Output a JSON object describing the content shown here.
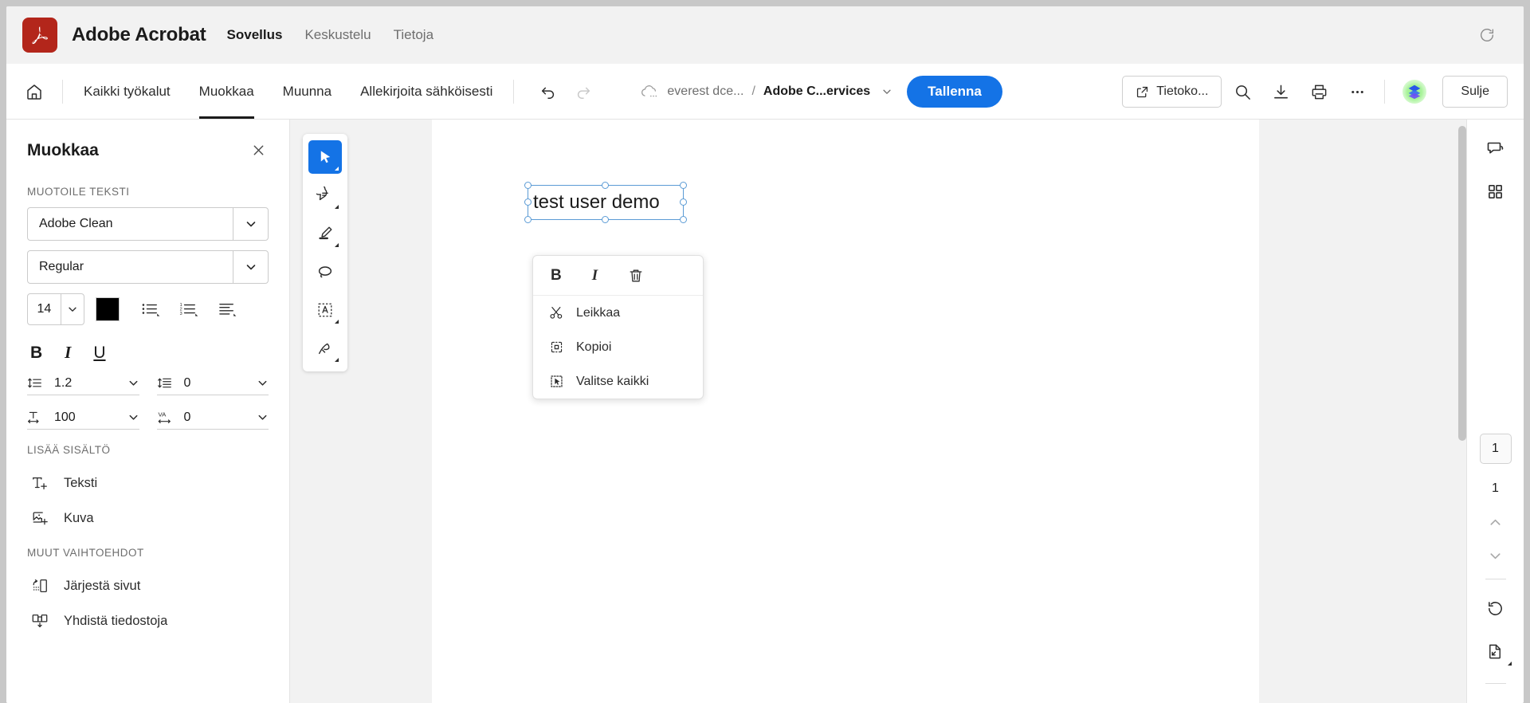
{
  "titlebar": {
    "logo_icon": "adobe-acrobat-logo",
    "app_name": "Adobe Acrobat",
    "tabs": [
      {
        "label": "Sovellus",
        "active": true
      },
      {
        "label": "Keskustelu",
        "active": false
      },
      {
        "label": "Tietoja",
        "active": false
      }
    ],
    "refresh_icon": "refresh-icon",
    "logo_color": "#b3261b"
  },
  "toolbar": {
    "home_icon": "home-icon",
    "menu": [
      {
        "label": "Kaikki työkalut",
        "active": false
      },
      {
        "label": "Muokkaa",
        "active": true
      },
      {
        "label": "Muunna",
        "active": false
      },
      {
        "label": "Allekirjoita sähköisesti",
        "active": false
      }
    ],
    "undo_icon": "undo-icon",
    "redo_icon": "redo-icon",
    "breadcrumb": {
      "cloud_icon": "cloud-icon",
      "owner": "everest dce...",
      "separator": "/",
      "file": "Adobe C...ervices",
      "caret_icon": "chevron-down-icon"
    },
    "save_label": "Tallenna",
    "save_color": "#1473e6",
    "computer_button": {
      "label": "Tietoko...",
      "icon": "open-in-new-icon"
    },
    "search_icon": "search-icon",
    "download_icon": "download-icon",
    "print_icon": "print-icon",
    "more_icon": "more-horizontal-icon",
    "avatar_icon": "acrobat-badge-avatar",
    "close_label": "Sulje"
  },
  "left_panel": {
    "title": "Muokkaa",
    "close_icon": "close-icon",
    "section_format": "MUOTOILE TEKSTI",
    "font_family": "Adobe Clean",
    "font_style": "Regular",
    "font_size": "14",
    "text_color": "#000000",
    "bullet_list_icon": "bulleted-list-icon",
    "number_list_icon": "numbered-list-icon",
    "align_icon": "text-align-icon",
    "bold_label": "B",
    "italic_label": "I",
    "underline_label": "U",
    "line_spacing": {
      "icon": "line-height-icon",
      "value": "1.2"
    },
    "paragraph_spacing": {
      "icon": "paragraph-spacing-icon",
      "value": "0"
    },
    "horizontal_scale": {
      "icon": "horizontal-scale-icon",
      "value": "100"
    },
    "tracking": {
      "icon": "tracking-va-icon",
      "value": "0"
    },
    "section_add": "LISÄÄ SISÄLTÖ",
    "add_items": [
      {
        "label": "Teksti",
        "icon": "add-text-icon"
      },
      {
        "label": "Kuva",
        "icon": "add-image-icon"
      }
    ],
    "section_other": "MUUT VAIHTOEHDOT",
    "other_items": [
      {
        "label": "Järjestä sivut",
        "icon": "organize-pages-icon"
      },
      {
        "label": "Yhdistä tiedostoja",
        "icon": "combine-files-icon"
      }
    ]
  },
  "vertical_tools": [
    {
      "icon": "select-cursor-icon",
      "active": true
    },
    {
      "icon": "comment-bubble-icon",
      "active": false
    },
    {
      "icon": "highlighter-icon",
      "active": false
    },
    {
      "icon": "lasso-icon",
      "active": false
    },
    {
      "icon": "text-box-icon",
      "active": false
    },
    {
      "icon": "signature-pen-icon",
      "active": false
    }
  ],
  "canvas": {
    "textbox_value": "test user demo",
    "selection_color": "#5b9bd5",
    "context_menu": {
      "bold_label": "B",
      "italic_label": "I",
      "delete_icon": "trash-icon",
      "items": [
        {
          "label": "Leikkaa",
          "icon": "scissors-icon"
        },
        {
          "label": "Kopioi",
          "icon": "copy-icon"
        },
        {
          "label": "Valitse kaikki",
          "icon": "select-all-icon"
        }
      ]
    }
  },
  "right_rail": {
    "comment_icon": "comment-panel-icon",
    "thumbnails_icon": "page-thumbnails-icon",
    "current_page": "1",
    "total_pages": "1",
    "prev_icon": "chevron-up-icon",
    "next_icon": "chevron-down-icon",
    "rotate_icon": "rotate-clockwise-icon",
    "fit_page_icon": "fit-page-icon"
  }
}
